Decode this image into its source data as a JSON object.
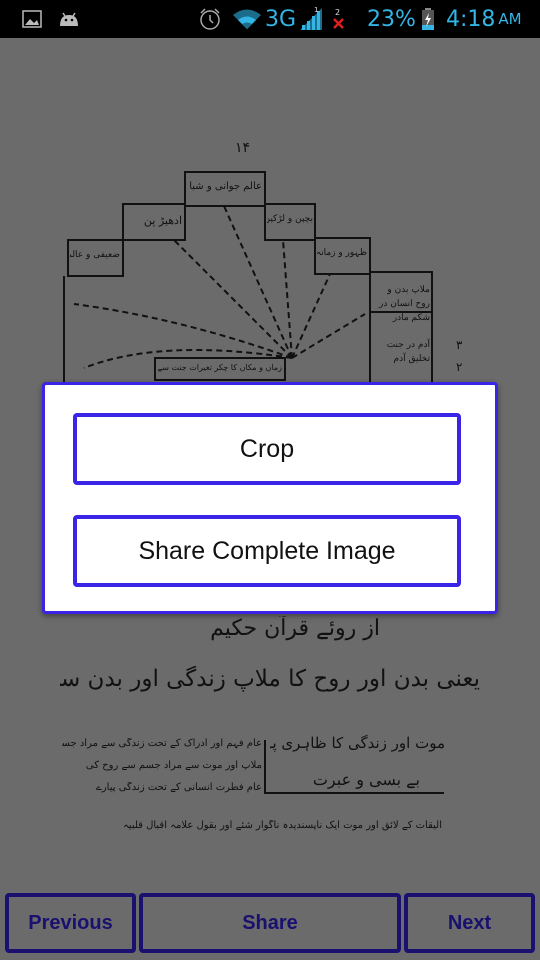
{
  "status_bar": {
    "icons": [
      "gallery-icon",
      "android-icon",
      "alarm-icon",
      "wifi-icon",
      "signal-icon",
      "no-sim-icon",
      "battery-charging-icon"
    ],
    "network_type": "3G",
    "signal_sim_label": "1",
    "no_sim_label": "2",
    "battery_percent": "23%",
    "time": "4:18",
    "ampm": "AM",
    "accent_color": "#33b5e5"
  },
  "document": {
    "page_number": "۱۴",
    "diagram_boxes": [
      "عالم جوانی و شباب",
      "ادھیڑ پن",
      "بچپن و لڑکپن",
      "ضعیفی و عالم پیری",
      "ظہور و زمانہ شیر خواری",
      "ملاپ بدن و روح انسان در شکم مادر",
      "آدم در جنت تخلیق آدم",
      "زماں و مکاں کا چکر تغیرات جنت سے نکلنے کے بعد"
    ],
    "side_numbers": [
      "۳",
      "۲"
    ],
    "heading": "از روئے قرآن حکیم",
    "title_line": "یعنی بدن اور روح کا ملاپ زندگی اور بدن سے روح کی علحدگی",
    "box_title": "موت اور زندگی کا ظاہری پہلو",
    "box_subtitle": "بے بسی و عبرت",
    "body_lines": [
      "عام فہم اور ادراک کے تحت زندگی سے مراد جسم",
      "ملاپ اور موت سے مراد جسم سے روح کی",
      "عام فطرت انسانی کے تحت زندگی پیارے"
    ],
    "footer_line": "الیقات کے لائق اور موت ایک ناپسندیدہ ناگوار شئے اور بقول علامہ اقبال قلبیہ"
  },
  "dialog": {
    "crop_label": "Crop",
    "share_complete_label": "Share Complete Image",
    "border_color": "#3a24e8"
  },
  "bottom_bar": {
    "previous_label": "Previous",
    "share_label": "Share",
    "next_label": "Next",
    "button_color": "#1a1070"
  }
}
